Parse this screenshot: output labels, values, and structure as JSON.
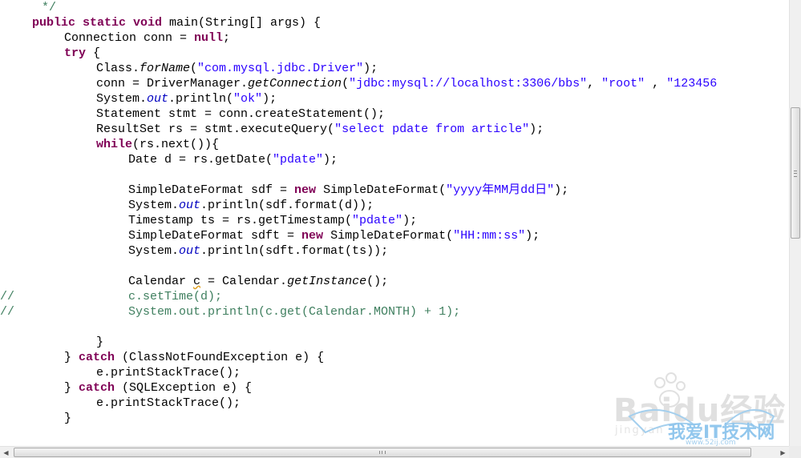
{
  "editor": {
    "line_comment_marker": "//",
    "comment_end": "*/"
  },
  "code": {
    "l1_kw": "public static void",
    "l1_rest": " main(String[] args) {",
    "l2_text": "Connection conn = ",
    "l2_kw": "null",
    "l2_end": ";",
    "l3_kw": "try",
    "l3_rest": " {",
    "l4_a": "Class.",
    "l4_b": "forName",
    "l4_c": "(",
    "l4_str": "\"com.mysql.jdbc.Driver\"",
    "l4_d": ");",
    "l5_a": "conn = DriverManager.",
    "l5_b": "getConnection",
    "l5_c": "(",
    "l5_str1": "\"jdbc:mysql://localhost:3306/bbs\"",
    "l5_d": ", ",
    "l5_str2": "\"root\"",
    "l5_e": " , ",
    "l5_str3": "\"123456",
    "l6_a": "System.",
    "l6_b": "out",
    "l6_c": ".println(",
    "l6_str": "\"ok\"",
    "l6_d": ");",
    "l7": "Statement stmt = conn.createStatement();",
    "l8_a": "ResultSet rs = stmt.executeQuery(",
    "l8_str": "\"select pdate from article\"",
    "l8_b": ");",
    "l9_kw": "while",
    "l9_rest": "(rs.next()){",
    "l10_a": "Date d = rs.getDate(",
    "l10_str": "\"pdate\"",
    "l10_b": ");",
    "l11_a": "SimpleDateFormat sdf = ",
    "l11_kw": "new",
    "l11_b": " SimpleDateFormat(",
    "l11_str": "\"yyyy年MM月dd日\"",
    "l11_c": ");",
    "l12_a": "System.",
    "l12_b": "out",
    "l12_c": ".println(sdf.format(d));",
    "l13_a": "Timestamp ts = rs.getTimestamp(",
    "l13_str": "\"pdate\"",
    "l13_b": ");",
    "l14_a": "SimpleDateFormat sdft = ",
    "l14_kw": "new",
    "l14_b": " SimpleDateFormat(",
    "l14_str": "\"HH:mm:ss\"",
    "l14_c": ");",
    "l15_a": "System.",
    "l15_b": "out",
    "l15_c": ".println(sdft.format(ts));",
    "l16_a": "Calendar ",
    "l16_var": "c",
    "l16_b": " = Calendar.",
    "l16_c": "getInstance",
    "l16_d": "();",
    "l17": "c.setTime(d);",
    "l18": "System.out.println(c.get(Calendar.MONTH) + 1);",
    "l19": "}",
    "l20_a": "} ",
    "l20_kw": "catch",
    "l20_b": " (ClassNotFoundException e) {",
    "l21": "e.printStackTrace();",
    "l22_a": "} ",
    "l22_kw": "catch",
    "l22_b": " (SQLException e) {",
    "l23": "e.printStackTrace();",
    "l24": "}"
  },
  "watermark": {
    "brand": "Baidu经验",
    "sub": "jingyan",
    "site": "我爱IT技术网",
    "url": "www.52ij.com"
  }
}
